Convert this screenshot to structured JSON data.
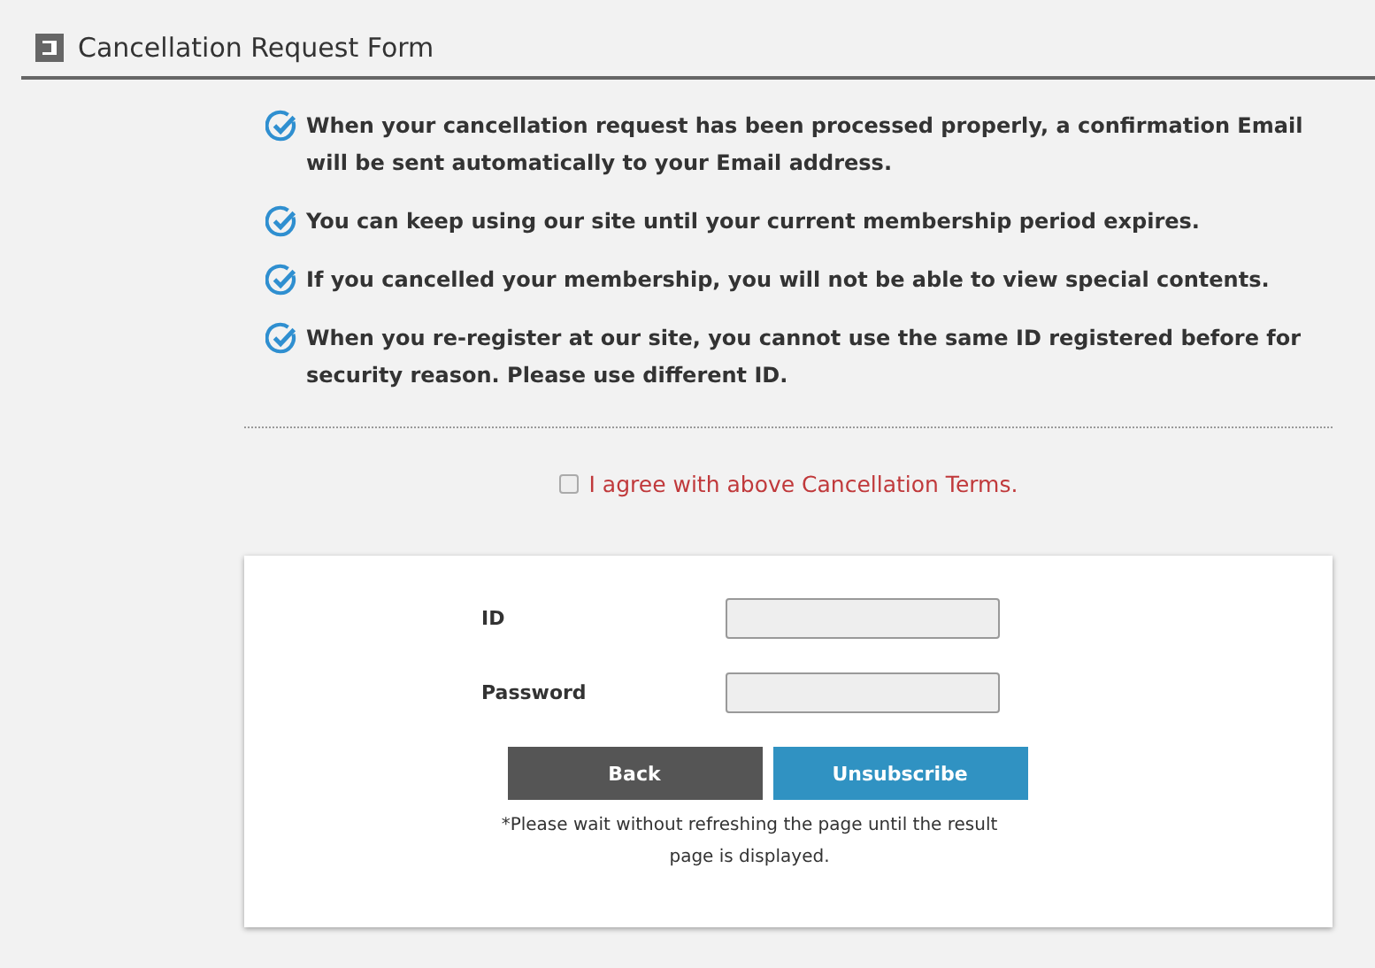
{
  "header": {
    "title": "Cancellation Request Form"
  },
  "terms": [
    "When your cancellation request has been processed properly, a confirmation Email will be sent automatically to your Email address.",
    "You can keep using our site until your current membership period expires.",
    "If you cancelled your membership, you will not be able to view special contents.",
    "When you re-register at our site, you cannot use the same ID registered before for security reason. Please use different ID."
  ],
  "agreement": {
    "label": "I agree with above Cancellation Terms.",
    "checked": false
  },
  "form": {
    "fields": [
      {
        "label": "ID"
      },
      {
        "label": "Password"
      }
    ],
    "buttons": [
      {
        "label": "Back",
        "kind": "secondary"
      },
      {
        "label": "Unsubscribe",
        "kind": "primary"
      }
    ],
    "note": "*Please wait without refreshing the page until the result page is displayed."
  }
}
